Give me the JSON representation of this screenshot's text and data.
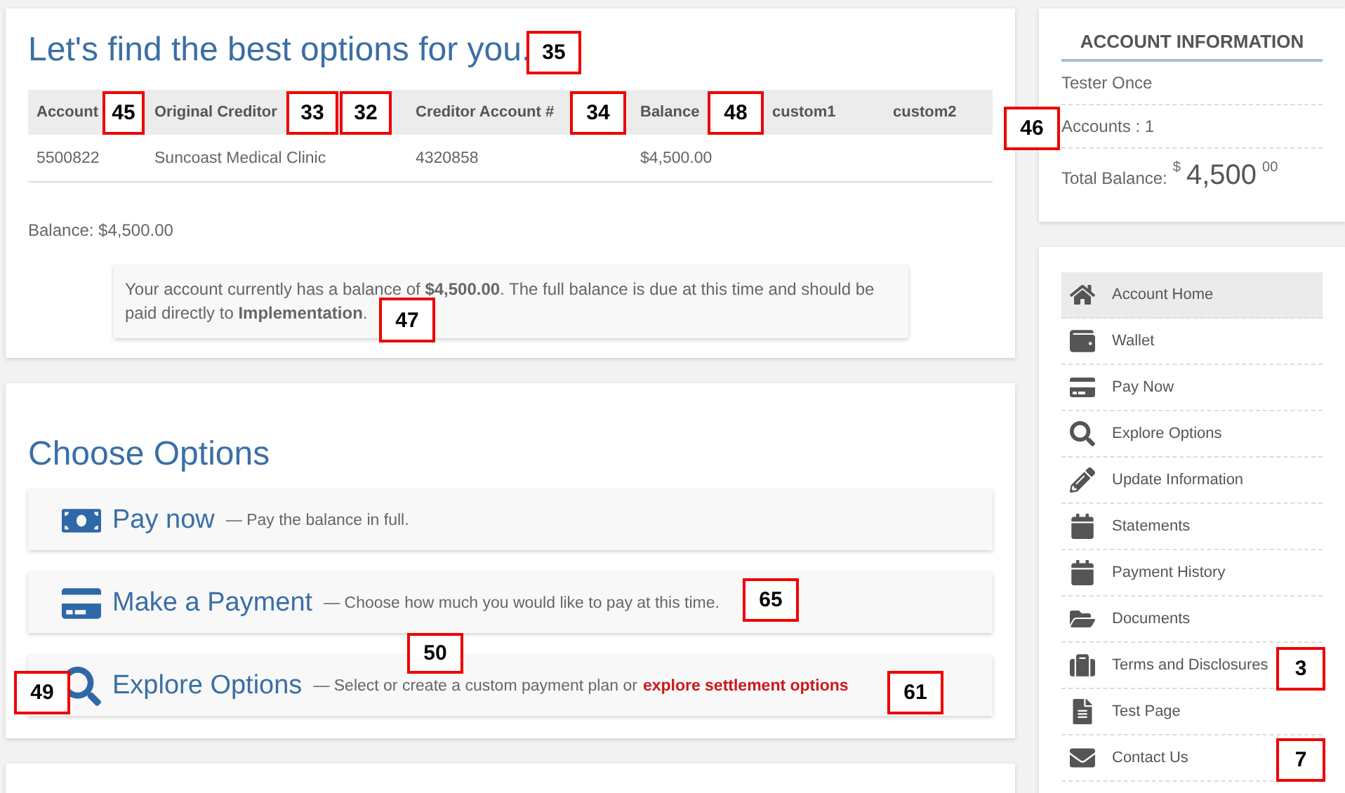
{
  "summary": {
    "title": "Let's find the best options for you.",
    "table": {
      "columns": [
        "Account",
        "Original Creditor",
        "Creditor Account #",
        "Balance",
        "custom1",
        "custom2"
      ],
      "rows": [
        [
          "5500822",
          "Suncoast Medical Clinic",
          "4320858",
          "$4,500.00",
          "",
          ""
        ]
      ]
    },
    "balance": "Balance: $4,500.00",
    "notice": "Your account currently has a balance of **$4,500.00**. The full balance is due at this time and should be paid directly to **Implementation**."
  },
  "options": {
    "title": "Choose Options",
    "items": [
      {
        "title": "Pay now",
        "description": "— Pay the balance in full."
      },
      {
        "title": "Make a Payment",
        "description": "— Choose how much you would like to pay at this time."
      },
      {
        "title": "Explore Options",
        "description": "— Select or create a custom payment plan or",
        "link": "explore settlement options"
      }
    ]
  },
  "account_info": {
    "title": "ACCOUNT INFORMATION",
    "name": "Tester Once",
    "accounts": "Accounts : 1",
    "total_label": "Total Balance:",
    "currency": "$",
    "amount": "4,500",
    "cents": "00"
  },
  "sidebar": {
    "items": [
      {
        "label": "Account Home",
        "selected": true
      },
      {
        "label": "Wallet",
        "selected": false
      },
      {
        "label": "Pay Now",
        "selected": false
      },
      {
        "label": "Explore Options",
        "selected": false
      },
      {
        "label": "Update Information",
        "selected": false
      },
      {
        "label": "Statements",
        "selected": false
      },
      {
        "label": "Payment History",
        "selected": false
      },
      {
        "label": "Documents",
        "selected": false
      },
      {
        "label": "Terms and Disclosures",
        "selected": false
      },
      {
        "label": "Test Page",
        "selected": false
      },
      {
        "label": "Contact Us",
        "selected": false
      }
    ]
  },
  "annotations": [
    {
      "label": "35"
    },
    {
      "label": "45"
    },
    {
      "label": "33"
    },
    {
      "label": "32"
    },
    {
      "label": "34"
    },
    {
      "label": "48"
    },
    {
      "label": "46"
    },
    {
      "label": "47"
    },
    {
      "label": "65"
    },
    {
      "label": "50"
    },
    {
      "label": "49"
    },
    {
      "label": "61"
    },
    {
      "label": "3"
    },
    {
      "label": "7"
    }
  ]
}
